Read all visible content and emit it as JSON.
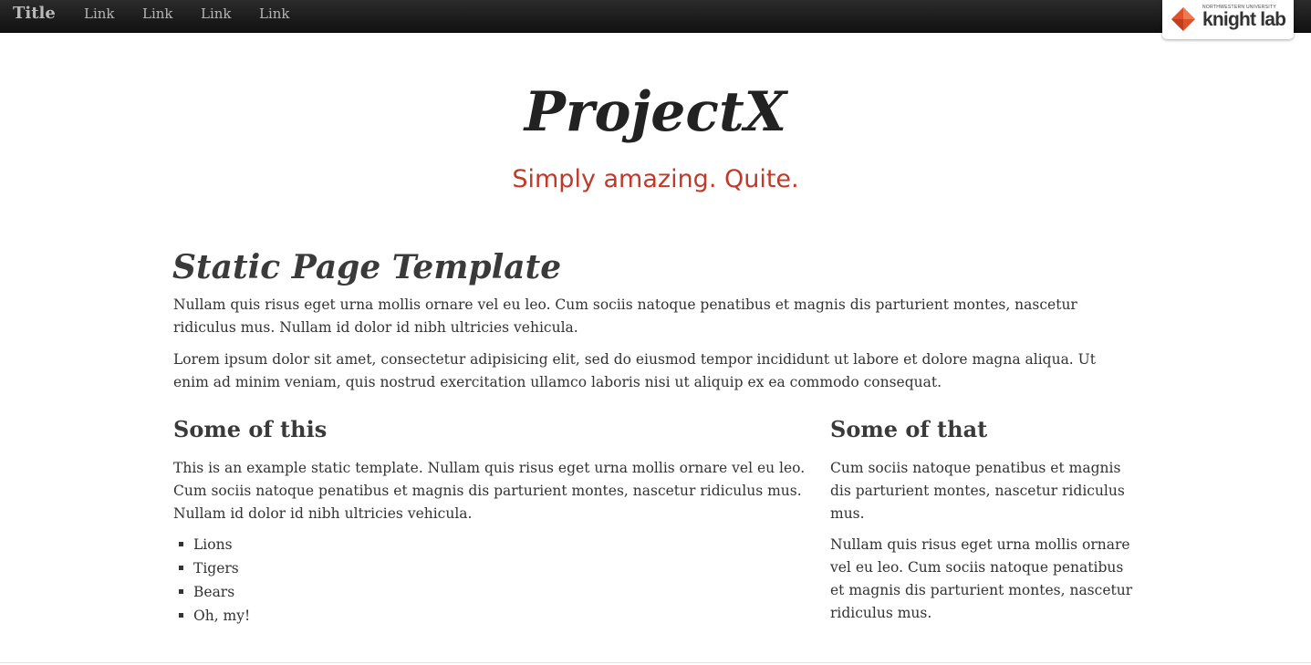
{
  "topbar": {
    "brand": "Title",
    "links": [
      "Link",
      "Link",
      "Link",
      "Link"
    ]
  },
  "badge": {
    "university": "NORTHWESTERN UNIVERSITY",
    "name": "knight lab",
    "icon": "knight-lab-diamond-icon",
    "accent_color": "#e0502a"
  },
  "hero": {
    "title": "ProjectX",
    "tagline": "Simply amazing. Quite.",
    "tagline_color": "#c0392b"
  },
  "main": {
    "heading": "Static Page Template",
    "paragraphs": [
      "Nullam quis risus eget urna mollis ornare vel eu leo. Cum sociis natoque penatibus et magnis dis parturient montes, nascetur ridiculus mus. Nullam id dolor id nibh ultricies vehicula.",
      "Lorem ipsum dolor sit amet, consectetur adipisicing elit, sed do eiusmod tempor incididunt ut labore et dolore magna aliqua. Ut enim ad minim veniam, quis nostrud exercitation ullamco laboris nisi ut aliquip ex ea commodo consequat."
    ]
  },
  "left_column": {
    "heading": "Some of this",
    "paragraph": "This is an example static template. Nullam quis risus eget urna mollis ornare vel eu leo. Cum sociis natoque penatibus et magnis dis parturient montes, nascetur ridiculus mus. Nullam id dolor id nibh ultricies vehicula.",
    "list": [
      "Lions",
      "Tigers",
      "Bears",
      "Oh, my!"
    ]
  },
  "right_column": {
    "heading": "Some of that",
    "paragraphs": [
      "Cum sociis natoque penatibus et magnis dis parturient montes, nascetur ridiculus mus.",
      "Nullam quis risus eget urna mollis ornare vel eu leo. Cum sociis natoque penatibus et magnis dis parturient montes, nascetur ridiculus mus."
    ]
  }
}
